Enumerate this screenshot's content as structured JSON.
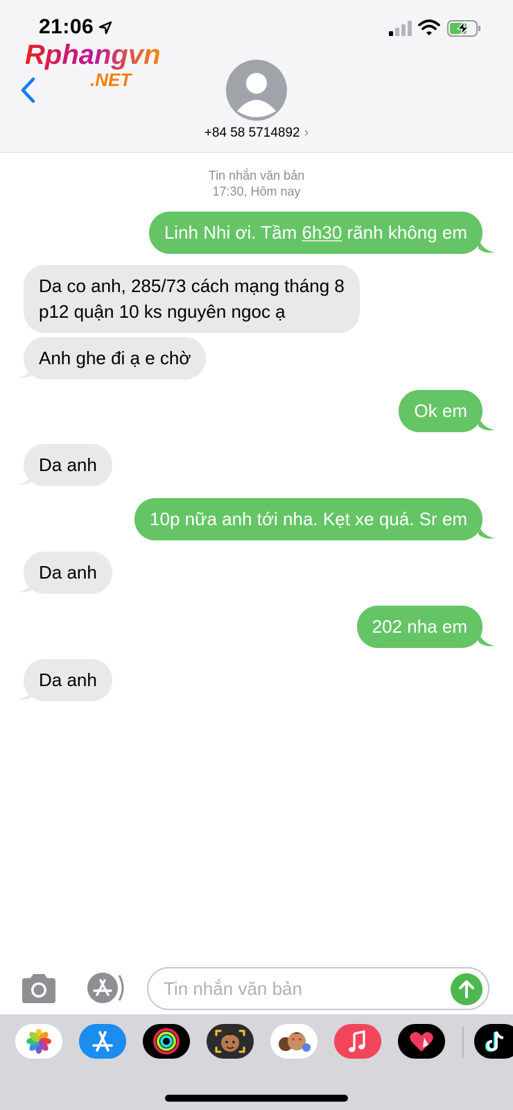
{
  "status_bar": {
    "time": "21:06",
    "icons": [
      "location-arrow-icon",
      "cellular-signal-icon",
      "wifi-icon",
      "battery-charging-icon"
    ]
  },
  "watermark": {
    "brand": "Rphangvn",
    "suffix": ".NET"
  },
  "header": {
    "back_icon": "chevron-left-icon",
    "avatar_icon": "person-placeholder-icon",
    "contact": "+84 58 5714892",
    "contact_chevron": "›"
  },
  "conversation": {
    "meta_type": "Tin nhắn văn bản",
    "meta_time": "17:30, Hôm nay",
    "messages": [
      {
        "direction": "out",
        "text_before": "Linh Nhi ơi. Tầm ",
        "text_link": "6h30",
        "text_after": " rãnh không em"
      },
      {
        "direction": "in",
        "line1": "Da co anh, 285/73 cách mạng tháng 8",
        "line2": "p12 quận 10 ks nguyên ngoc ạ"
      },
      {
        "direction": "in",
        "text": "Anh ghe đi ạ e chờ"
      },
      {
        "direction": "out",
        "text": "Ok em"
      },
      {
        "direction": "in",
        "text": "Da anh"
      },
      {
        "direction": "out",
        "text": "10p nữa anh tới nha. Kẹt xe quá. Sr em"
      },
      {
        "direction": "in",
        "text": "Da anh"
      },
      {
        "direction": "out",
        "text": "202 nha em"
      },
      {
        "direction": "in",
        "text": "Da anh"
      }
    ]
  },
  "composer": {
    "camera_icon": "camera-icon",
    "apps_icon": "app-store-icon",
    "placeholder": "Tin nhắn văn bản",
    "send_icon": "send-arrow-up-icon"
  },
  "app_drawer": {
    "apps": [
      "photos-icon",
      "app-store-icon",
      "activity-icon",
      "memoji-icon",
      "animoji-stickers-icon",
      "music-icon",
      "digital-touch-icon",
      "tiktok-icon"
    ]
  },
  "colors": {
    "outgoing_bubble": "#65c466",
    "incoming_bubble": "#e9e9eb",
    "accent": "#1a7cf5",
    "header_bg": "#f5f5f7"
  }
}
